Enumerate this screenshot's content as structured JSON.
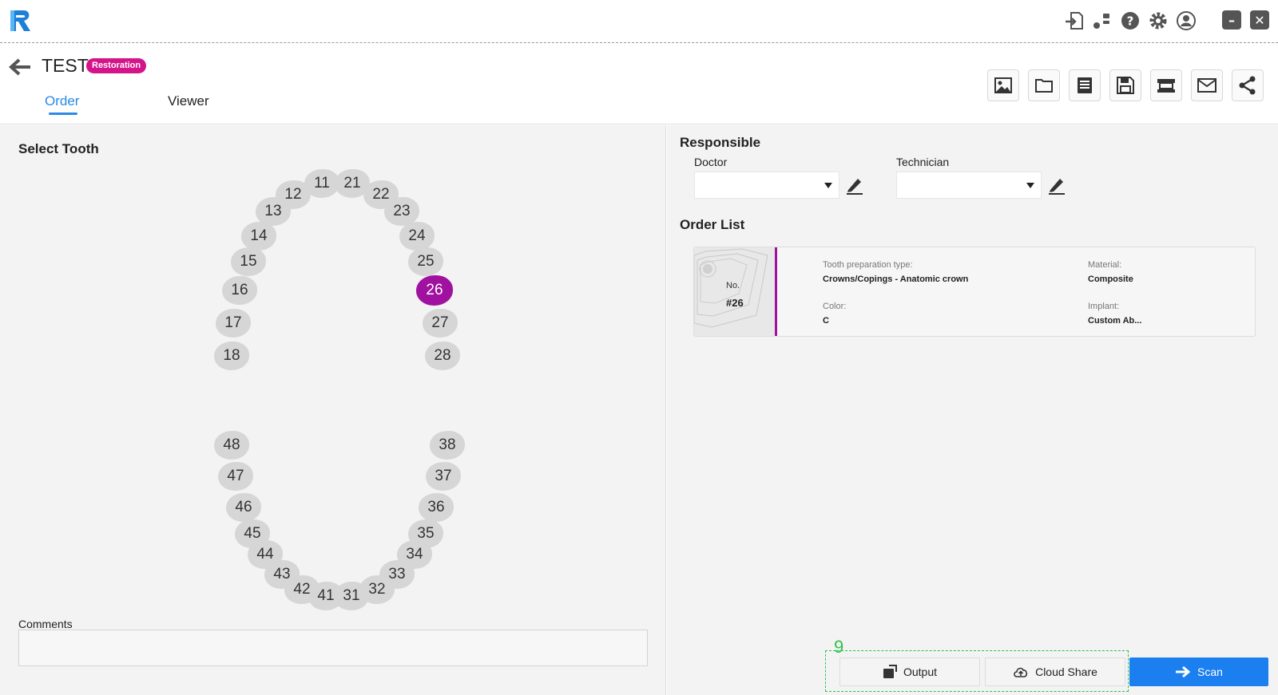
{
  "header": {
    "case_title": "TEST",
    "badge": "Restoration",
    "tabs": [
      {
        "label": "Order"
      },
      {
        "label": "Viewer"
      }
    ]
  },
  "left": {
    "select_tooth_title": "Select Tooth",
    "selected_tooth": "26",
    "teeth": [
      "11",
      "12",
      "13",
      "14",
      "15",
      "16",
      "17",
      "18",
      "21",
      "22",
      "23",
      "24",
      "25",
      "26",
      "27",
      "28",
      "31",
      "32",
      "33",
      "34",
      "35",
      "36",
      "37",
      "38",
      "41",
      "42",
      "43",
      "44",
      "45",
      "46",
      "47",
      "48"
    ],
    "comments_label": "Comments",
    "comments_value": ""
  },
  "right": {
    "responsible_title": "Responsible",
    "doctor_label": "Doctor",
    "doctor_value": "",
    "technician_label": "Technician",
    "technician_value": "",
    "order_list_title": "Order List",
    "order": {
      "no_label": "No.",
      "no_value": "#26",
      "prep_label": "Tooth preparation type:",
      "prep_value": "Crowns/Copings - Anatomic crown",
      "material_label": "Material:",
      "material_value": "Composite",
      "color_label": "Color:",
      "color_value": "C",
      "implant_label": "Implant:",
      "implant_value": "Custom Ab..."
    }
  },
  "footer": {
    "highlight_number": "9",
    "output_label": "Output",
    "cloud_share_label": "Cloud Share",
    "scan_label": "Scan"
  },
  "icons": {
    "titlebar": [
      "import-icon",
      "connect-icon",
      "help-icon",
      "settings-icon",
      "account-icon",
      "minimize-icon",
      "close-icon"
    ],
    "toolbar": [
      "image-icon",
      "folder-icon",
      "document-icon",
      "save-icon",
      "scanner-icon",
      "mail-icon",
      "share-icon"
    ]
  },
  "colors": {
    "accent": "#2a8ae6",
    "selected_tooth": "#a0119f",
    "badge": "#d4148a",
    "scan_button": "#1b7ff0",
    "highlight": "#2cc24a"
  }
}
